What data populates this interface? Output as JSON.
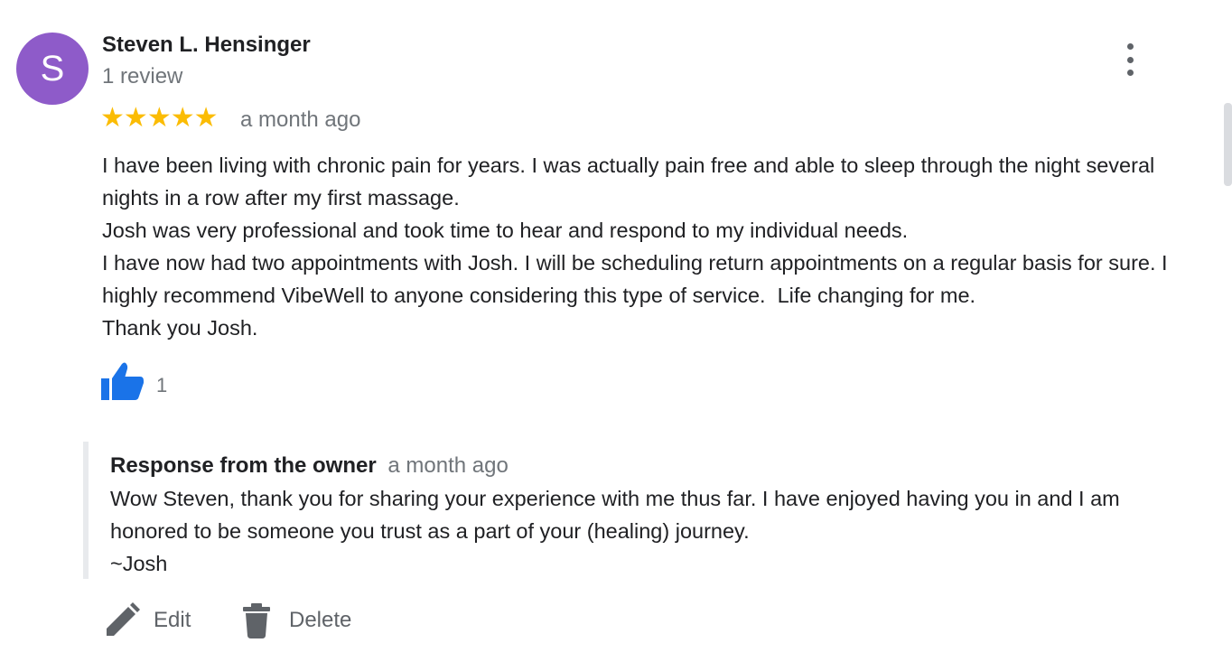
{
  "colors": {
    "avatar_bg": "#8e5bc9",
    "star": "#fbbc04",
    "like_blue": "#1a73e8"
  },
  "review": {
    "avatar_letter": "S",
    "reviewer_name": "Steven L. Hensinger",
    "review_count": "1 review",
    "rating": 5,
    "date": "a month ago",
    "paragraphs": [
      "I have been living with chronic pain for years. I was actually pain free and able to sleep through the night several nights in a row after my first massage.",
      "Josh was very professional and took time to hear and respond to my individual needs.",
      "I have now had two appointments with Josh. I will be scheduling return appointments on a regular basis for sure. I highly recommend VibeWell to anyone considering this type of service.  Life changing for me.",
      "Thank you Josh."
    ],
    "like_count": "1",
    "more_icon": "more-vert-icon"
  },
  "response": {
    "title": "Response from the owner",
    "date": "a month ago",
    "paragraphs": [
      "Wow Steven, thank you for sharing your experience with me thus far. I have enjoyed having you in and I am honored to be someone you trust as a part of your (healing) journey.",
      "~Josh"
    ]
  },
  "actions": {
    "edit_label": "Edit",
    "edit_icon": "pencil-icon",
    "delete_label": "Delete",
    "delete_icon": "trash-icon"
  }
}
